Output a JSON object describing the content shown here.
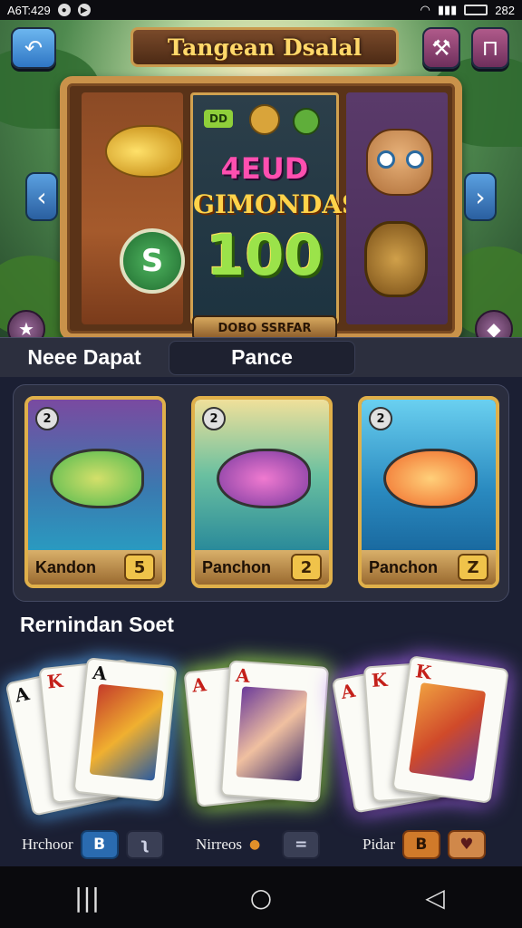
{
  "status_bar": {
    "time": "A6T:429",
    "right_text": "282"
  },
  "header": {
    "title": "Tangean Dsalal",
    "back_icon": "back-arrow-icon",
    "tool_icon": "wrench-icon",
    "menu_icon": "menu-icon"
  },
  "slot": {
    "badge": "DD",
    "jackpot_line1": "4EUD",
    "jackpot_line2": "GIMONDAS",
    "jackpot_line3": "100",
    "coin_symbol": "S",
    "caption": "DOBO SSRFAR"
  },
  "tabs": {
    "tab1": "Neee Dapat",
    "tab2": "Pance"
  },
  "fish_cards": [
    {
      "name": "Kandon",
      "badge": "5",
      "number": "2",
      "color": "#4fb84f"
    },
    {
      "name": "Panchon",
      "badge": "2",
      "number": "2",
      "color": "#c04ab0"
    },
    {
      "name": "Panchon",
      "badge": "Z",
      "number": "2",
      "color": "#f08a3a"
    }
  ],
  "section_title": "Rernindan Soet",
  "card_groups": [
    {
      "label": "Hrchoor",
      "btn1": "B",
      "btn2": "ʅ",
      "corner1": "A",
      "corner2": "K",
      "corner3": "A"
    },
    {
      "label": "Nirreos",
      "btn1": "=",
      "corner1": "A",
      "corner2": "A"
    },
    {
      "label": "Pidar",
      "btn1": "B",
      "btn2": "♥",
      "corner1": "A",
      "corner2": "K",
      "corner3": "K"
    }
  ],
  "nav": {
    "recent": "|||",
    "home": "○",
    "back": "◁"
  }
}
